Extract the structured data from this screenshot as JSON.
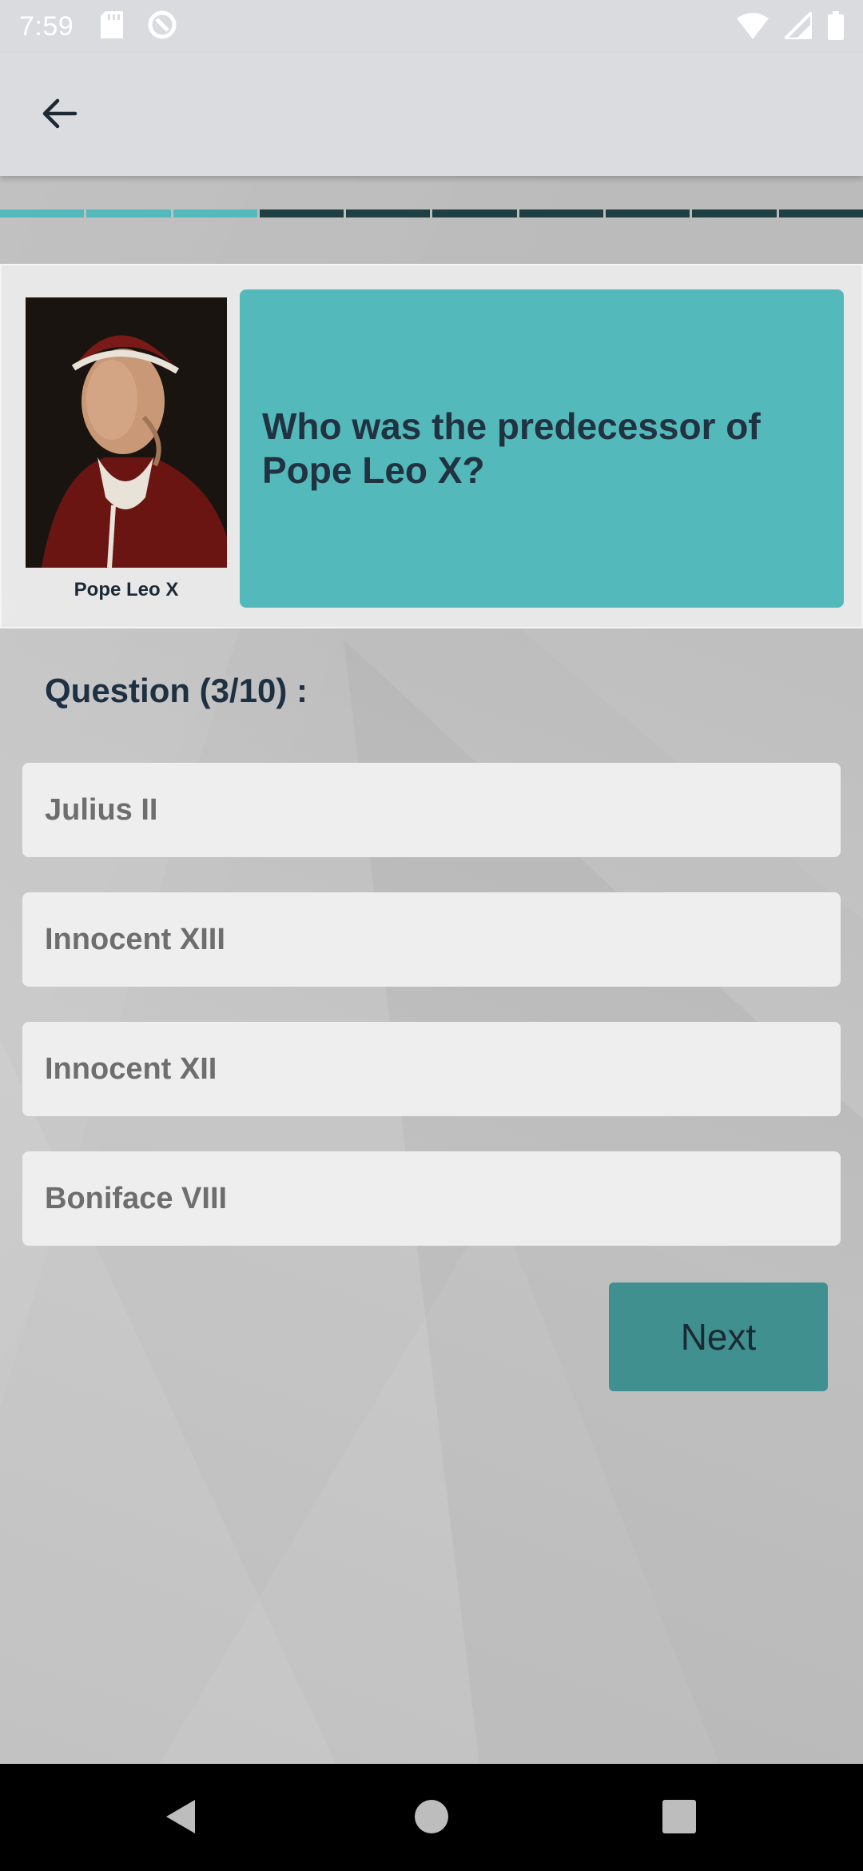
{
  "status_bar": {
    "time": "7:59",
    "icons": [
      "sd-card-icon",
      "data-saver-icon",
      "wifi-icon",
      "signal-icon",
      "battery-icon"
    ]
  },
  "app_bar": {
    "back_icon": "arrow-left-icon"
  },
  "progress": {
    "total": 10,
    "completed": 3,
    "colors": {
      "done": "#54b9bb",
      "pending": "#1f3f43"
    }
  },
  "question_card": {
    "image_caption": "Pope Leo X",
    "question": "Who was the predecessor of Pope Leo X?"
  },
  "counter": "Question (3/10) :",
  "answers": [
    {
      "label": "Julius II"
    },
    {
      "label": "Innocent XIII"
    },
    {
      "label": "Innocent XII"
    },
    {
      "label": "Boniface VIII"
    }
  ],
  "next_label": "Next",
  "nav_bar": {
    "icons": [
      "back-triangle-icon",
      "home-circle-icon",
      "recents-square-icon"
    ]
  },
  "colors": {
    "accent": "#54b9bb",
    "button": "#40908f",
    "text_dark": "#1e3142"
  }
}
